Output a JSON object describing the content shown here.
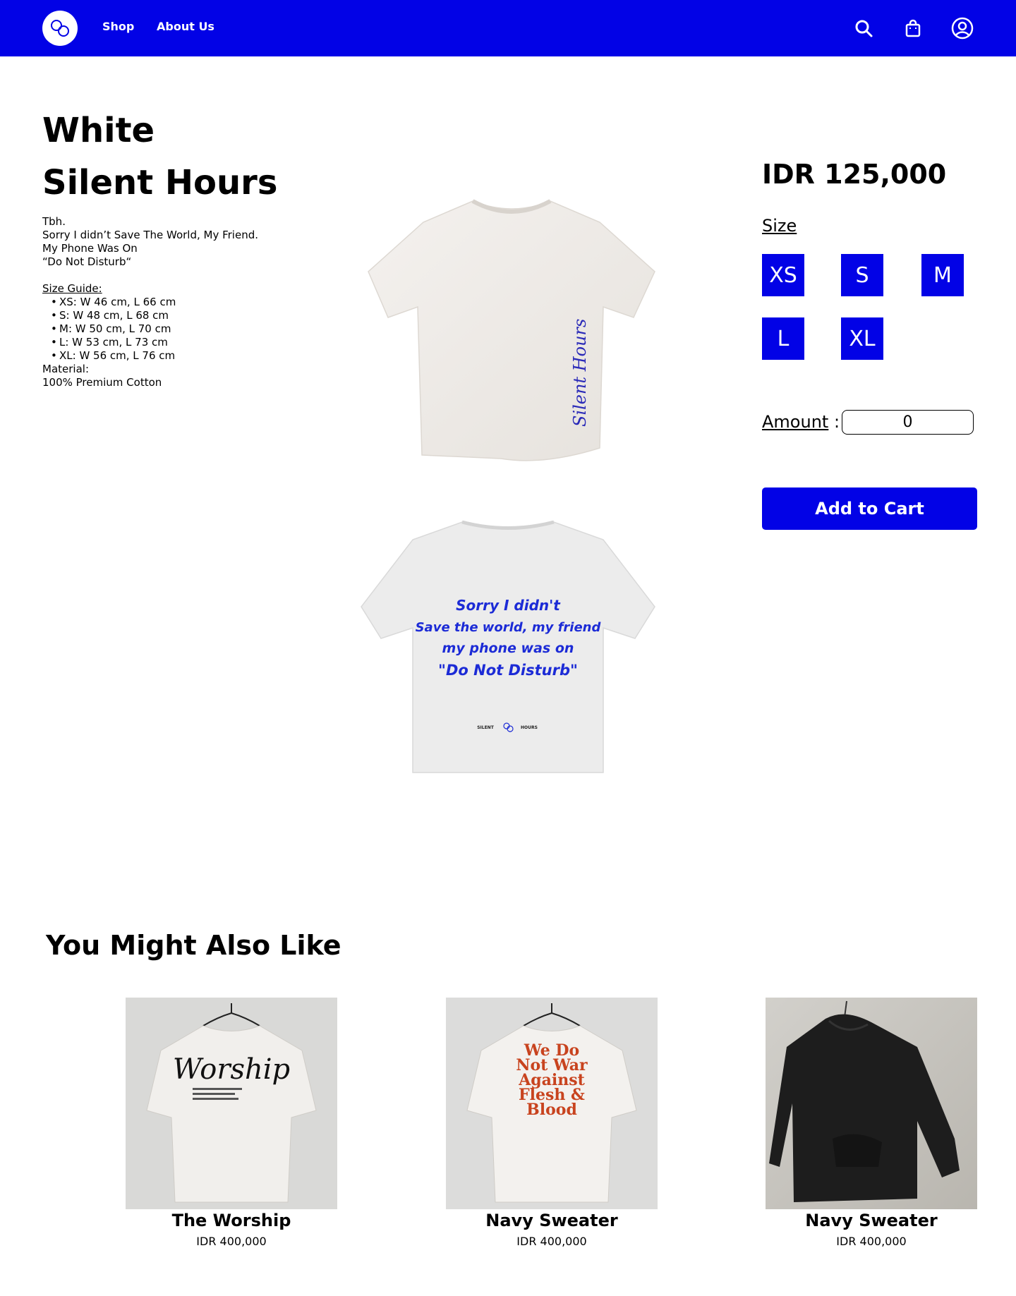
{
  "nav": {
    "links": [
      "Shop",
      "About Us"
    ],
    "brand_color": "#0202e6"
  },
  "product": {
    "title_line1": "White",
    "title_line2": "Silent Hours",
    "description": [
      "Tbh.",
      "Sorry I didn’t Save The World, My Friend.",
      "My Phone Was On",
      "“Do Not Disturb“"
    ],
    "size_guide_title": "Size Guide:",
    "size_guide": [
      "XS: W 46 cm, L 66 cm",
      "S: W 48 cm, L 68 cm",
      "M: W 50 cm, L 70 cm",
      "L: W 53 cm, L 73 cm",
      "XL: W 56 cm, L 76 cm"
    ],
    "material_label": "Material:",
    "material_value": "100% Premium Cotton",
    "back_print": [
      "Sorry I didn't",
      "Save the world, my friend",
      "my phone was on",
      "\"Do Not Disturb\""
    ],
    "side_print": "Silent Hours",
    "tag_left": "SILENT",
    "tag_right": "HOURS"
  },
  "purchase": {
    "price": "IDR 125,000",
    "size_label": "Size",
    "sizes": [
      "XS",
      "S",
      "M",
      "L",
      "XL"
    ],
    "amount_label": "Amount",
    "amount_separator": " :",
    "amount_value": "0",
    "add_to_cart": "Add to Cart"
  },
  "recommendations": {
    "heading": "You Might Also Like",
    "items": [
      {
        "name": "The Worship",
        "price": "IDR 400,000",
        "print": "Worship"
      },
      {
        "name": "Navy Sweater",
        "price": "IDR 400,000",
        "print": "We Do Not War Against Flesh & Blood"
      },
      {
        "name": "Navy Sweater",
        "price": "IDR 400,000",
        "print": ""
      }
    ]
  }
}
